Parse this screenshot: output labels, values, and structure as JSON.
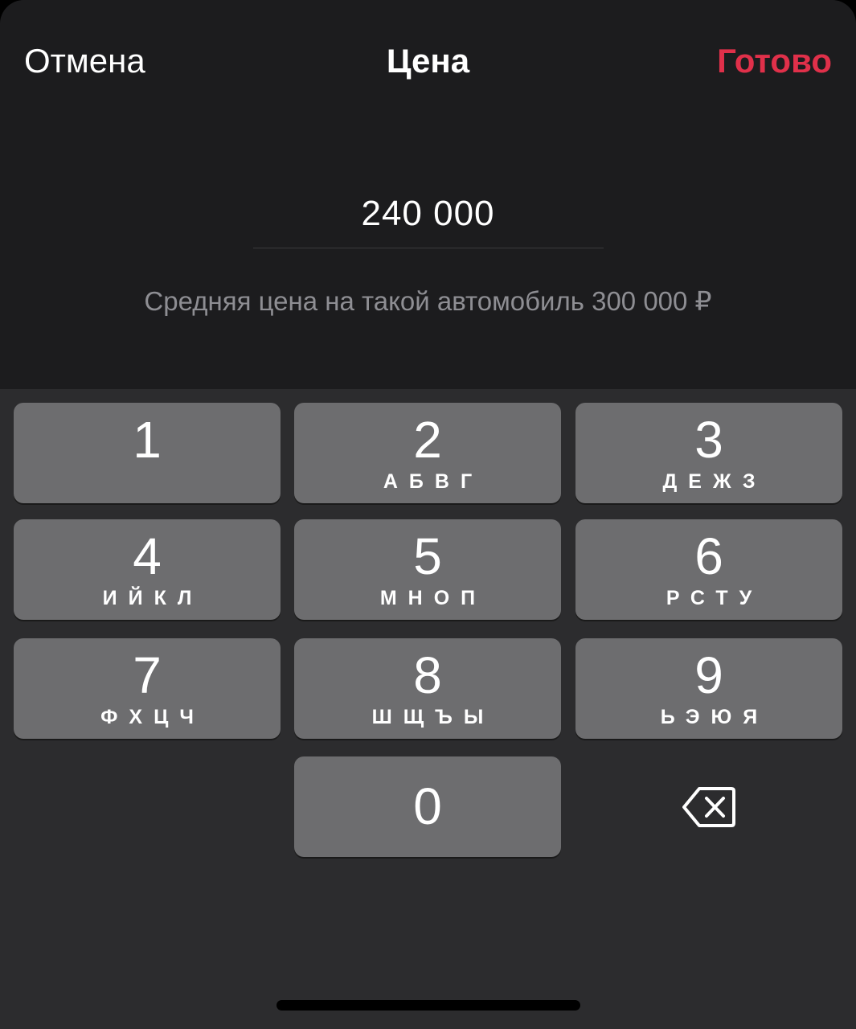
{
  "nav": {
    "cancel_label": "Отмена",
    "title": "Цена",
    "done_label": "Готово"
  },
  "price": {
    "value": "240 000",
    "hint": "Средняя цена на такой автомобиль 300 000 ₽"
  },
  "keypad": {
    "keys": [
      {
        "digit": "1",
        "letters": ""
      },
      {
        "digit": "2",
        "letters": "АБВГ"
      },
      {
        "digit": "3",
        "letters": "ДЕЖЗ"
      },
      {
        "digit": "4",
        "letters": "ИЙКЛ"
      },
      {
        "digit": "5",
        "letters": "МНОП"
      },
      {
        "digit": "6",
        "letters": "РСТУ"
      },
      {
        "digit": "7",
        "letters": "ФХЦЧ"
      },
      {
        "digit": "8",
        "letters": "ШЩЪЫ"
      },
      {
        "digit": "9",
        "letters": "ЬЭЮЯ"
      },
      {
        "digit": "0",
        "letters": ""
      }
    ],
    "backspace_icon": "backspace-icon"
  },
  "colors": {
    "accent": "#e0304a",
    "background": "#1c1c1e",
    "keyboard_background": "#2c2c2e",
    "key": "#6d6d6f",
    "hint_text": "#8e8e93"
  }
}
